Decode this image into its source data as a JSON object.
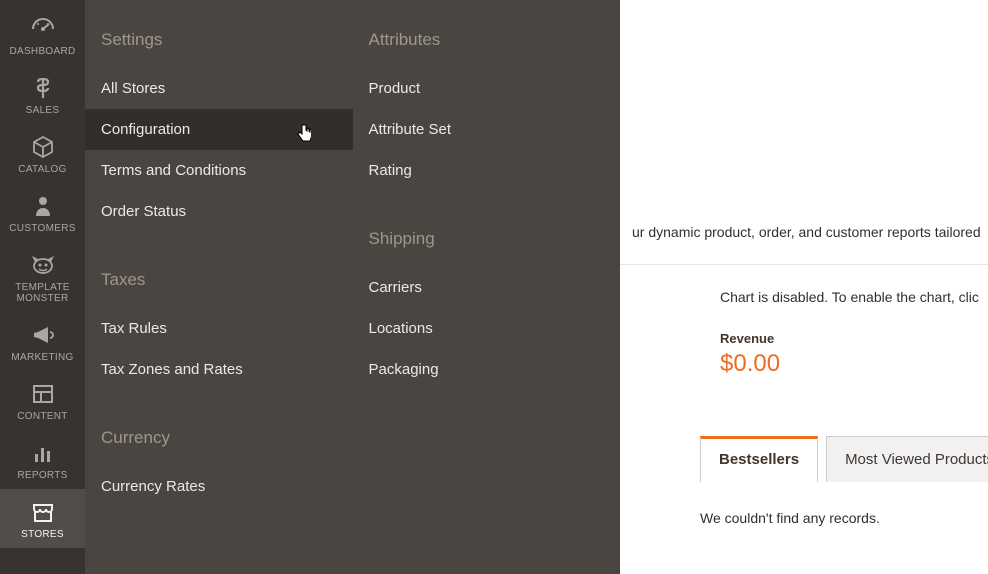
{
  "sidebar": [
    {
      "id": "dashboard",
      "label": "DASHBOARD",
      "icon": "gauge"
    },
    {
      "id": "sales",
      "label": "SALES",
      "icon": "dollar"
    },
    {
      "id": "catalog",
      "label": "CATALOG",
      "icon": "box"
    },
    {
      "id": "customers",
      "label": "CUSTOMERS",
      "icon": "person"
    },
    {
      "id": "template-monster",
      "label": "TEMPLATE MONSTER",
      "icon": "monster"
    },
    {
      "id": "marketing",
      "label": "MARKETING",
      "icon": "megaphone"
    },
    {
      "id": "content",
      "label": "CONTENT",
      "icon": "layout"
    },
    {
      "id": "reports",
      "label": "REPORTS",
      "icon": "bars"
    },
    {
      "id": "stores",
      "label": "STORES",
      "icon": "storefront"
    }
  ],
  "flyout": {
    "col1": [
      {
        "type": "title",
        "text": "Settings"
      },
      {
        "type": "link",
        "text": "All Stores"
      },
      {
        "type": "link",
        "text": "Configuration",
        "hovered": true
      },
      {
        "type": "link",
        "text": "Terms and Conditions"
      },
      {
        "type": "link",
        "text": "Order Status"
      },
      {
        "type": "spacer"
      },
      {
        "type": "title",
        "text": "Taxes"
      },
      {
        "type": "link",
        "text": "Tax Rules"
      },
      {
        "type": "link",
        "text": "Tax Zones and Rates"
      },
      {
        "type": "spacer"
      },
      {
        "type": "title",
        "text": "Currency"
      },
      {
        "type": "link",
        "text": "Currency Rates"
      }
    ],
    "col2": [
      {
        "type": "title",
        "text": "Attributes"
      },
      {
        "type": "link",
        "text": "Product"
      },
      {
        "type": "link",
        "text": "Attribute Set"
      },
      {
        "type": "link",
        "text": "Rating"
      },
      {
        "type": "spacer"
      },
      {
        "type": "title",
        "text": "Shipping"
      },
      {
        "type": "link",
        "text": "Carriers"
      },
      {
        "type": "link",
        "text": "Locations"
      },
      {
        "type": "link",
        "text": "Packaging"
      }
    ]
  },
  "main": {
    "hint_partial": "ur dynamic product, order, and customer reports tailored",
    "chart_hint_partial": "Chart is disabled. To enable the chart, clic",
    "stat_label": "Revenue",
    "stat_value": "$0.00",
    "tabs": [
      {
        "label": "Bestsellers",
        "active": true
      },
      {
        "label": "Most Viewed Products",
        "active": false
      }
    ],
    "no_records": "We couldn't find any records."
  }
}
